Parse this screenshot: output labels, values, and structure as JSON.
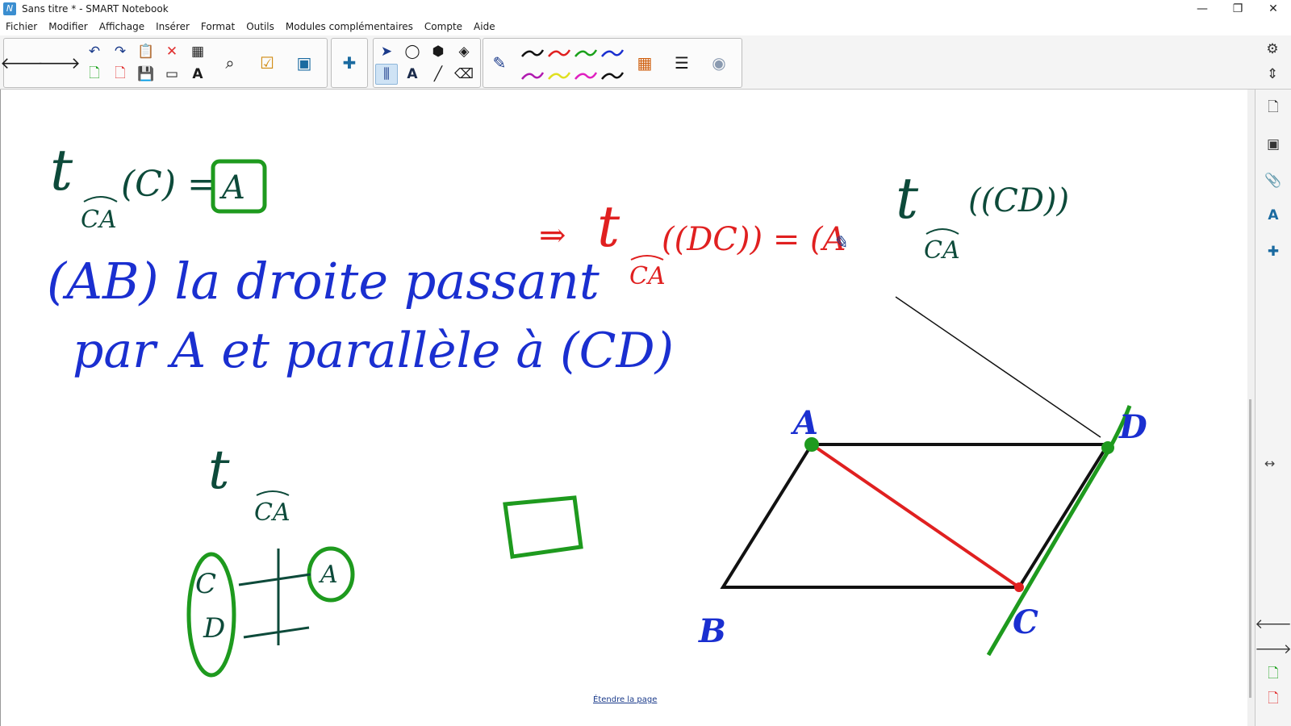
{
  "window": {
    "title": "Sans titre * - SMART Notebook",
    "minimize": "—",
    "restore": "❐",
    "close": "✕"
  },
  "menu": [
    "Fichier",
    "Modifier",
    "Affichage",
    "Insérer",
    "Format",
    "Outils",
    "Modules complémentaires",
    "Compte",
    "Aide"
  ],
  "toolbar": {
    "back": "🡐",
    "forward": "🡒",
    "undo": "↶",
    "redo": "↷",
    "paste": "📋",
    "delete": "✕",
    "table": "▦",
    "new_page": "🗋",
    "delete_page": "🗋",
    "save": "💾",
    "screen_shade": "▭",
    "spellcheck": "A",
    "screen_capture": "⌕",
    "activity": "☑",
    "lab": "▣",
    "addons": "✚",
    "select": "➤",
    "shapes": "◯",
    "polygon": "⬢",
    "fill": "◈",
    "measure": "⫼",
    "text": "A",
    "line": "╱",
    "eraser": "⌫",
    "pen": "✎",
    "colors": "▦",
    "properties": "☰",
    "doc_camera": "◉"
  },
  "pen_colors": [
    "#111111",
    "#e02020",
    "#1aa11a",
    "#1a2fd0",
    "#b01ab0",
    "#e0e020",
    "#e020c0",
    "#111111"
  ],
  "sidebar": {
    "settings": "⚙",
    "move": "⇕",
    "page_sorter": "🗋",
    "gallery": "▣",
    "attachments": "📎",
    "properties": "A",
    "addons": "✚",
    "prev": "🡐",
    "next": "🡒",
    "add_page": "🗋",
    "delete_page": "🗋",
    "resize": "↔"
  },
  "canvas": {
    "extend_link": "Étendre la page"
  },
  "handwriting": {
    "line1": "t",
    "line1_sub": "CA",
    "line1_rest": "(C) =",
    "line1_boxed": "A",
    "line2": "(AB) la droite passant",
    "line3": "par A et parallèle à (CD)",
    "red_arrow": "⇒",
    "red_t": "t",
    "red_sub": "CA",
    "red_rest": "((DC)) = (A",
    "right_t": "t",
    "right_sub": "CA",
    "right_rest": "((CD))",
    "diag_t": "t",
    "diag_sub": "CA",
    "diag_left1": "C",
    "diag_left2": "D",
    "diag_right": "A",
    "pt_A": "A",
    "pt_B": "B",
    "pt_C": "C",
    "pt_D": "D"
  },
  "colors": {
    "blue_ink": "#1a2fd0",
    "green_ink": "#1e9a1e",
    "red_ink": "#e02020",
    "dark_ink": "#0d4a3a",
    "black_ink": "#111111"
  }
}
